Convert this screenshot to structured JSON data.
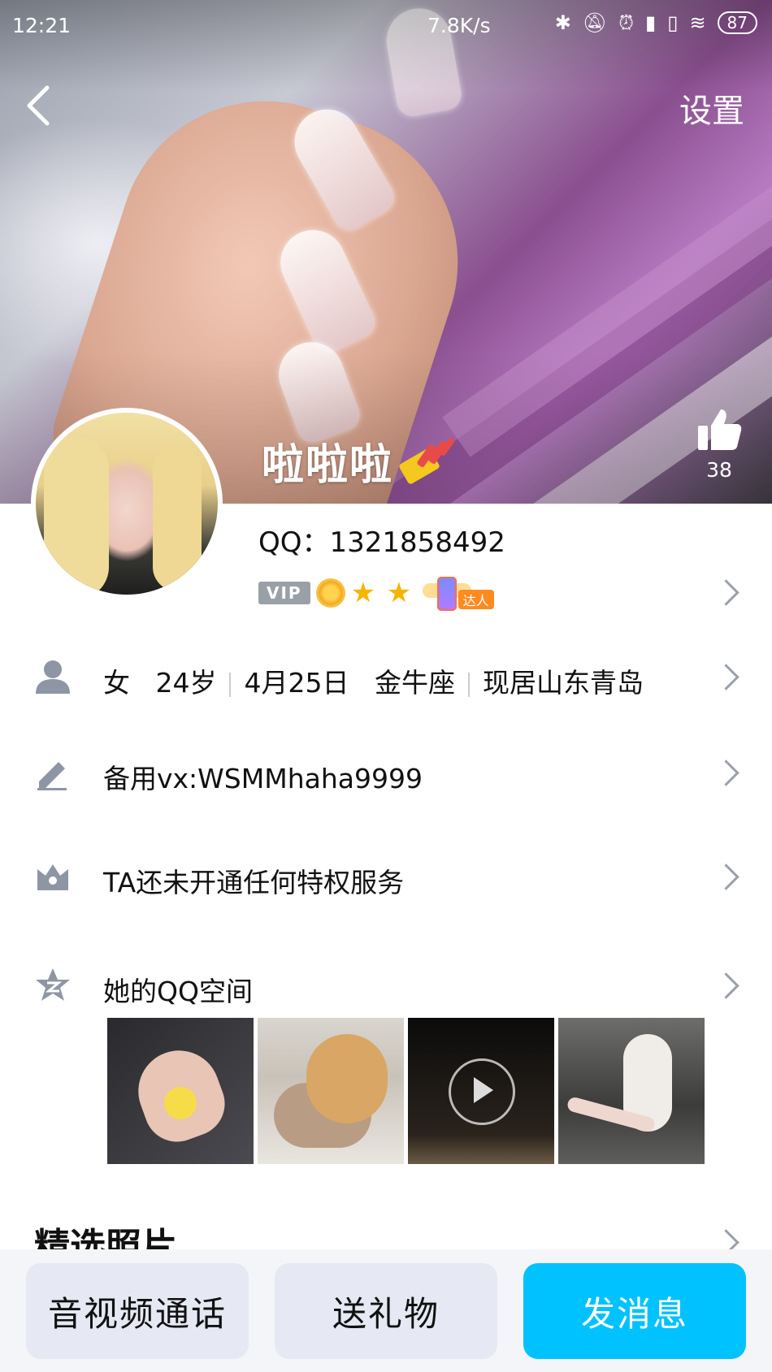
{
  "status_bar": {
    "time": "12:21",
    "net_speed": "7.8K/s",
    "battery": "87"
  },
  "header": {
    "settings_label": "设置"
  },
  "profile": {
    "nickname": "啦啦啦",
    "likes": "38",
    "qq_label": "QQ：1321858492",
    "vip_label": "VIP",
    "daren_label": "达人"
  },
  "info_rows": {
    "basic": {
      "gender": "女",
      "age": "24岁",
      "birthday": "4月25日",
      "zodiac": "金牛座",
      "location": "现居山东青岛"
    },
    "signature": "备用vx:WSMMhaha9999",
    "privilege": "TA还未开通任何特权服务",
    "qzone": "她的QQ空间"
  },
  "sections": {
    "featured_photos": "精选照片"
  },
  "bottom_actions": {
    "call": "音视频通话",
    "gift": "送礼物",
    "message": "发消息"
  },
  "colors": {
    "primary_button": "#00c2ff",
    "secondary_button": "#e6e9f3",
    "icon_gray": "#8e96a5"
  }
}
